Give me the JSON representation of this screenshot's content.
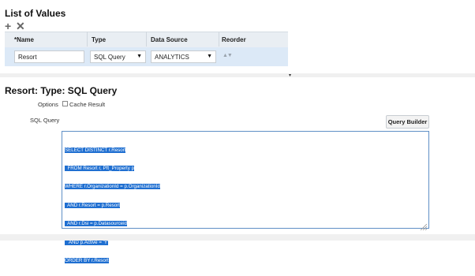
{
  "list_section": {
    "title": "List of Values",
    "add_icon": "plus-icon",
    "delete_icon": "x-icon",
    "columns": [
      "*Name",
      "Type",
      "Data Source",
      "Reorder"
    ],
    "row": {
      "name": "Resort",
      "type": "SQL Query",
      "data_source": "ANALYTICS",
      "reorder_icon": "up-down-arrows-icon"
    }
  },
  "detail": {
    "title": "Resort: Type: SQL Query",
    "options_label": "Options",
    "cache_label": "Cache Result",
    "cache_checked": false,
    "sql_label": "SQL Query",
    "query_builder": "Query Builder",
    "sql_lines": [
      "SELECT DISTINCT r.Resort",
      "  FROM Resort r, Pft_Property p",
      "WHERE r.OrganizationId = p.OrganizationId",
      "  AND r.Resort = p.Resort",
      "  AND r.Dsi = p.Datasourceid",
      "   AND p.Active = 'Y'",
      "ORDER BY r.Resort"
    ]
  }
}
